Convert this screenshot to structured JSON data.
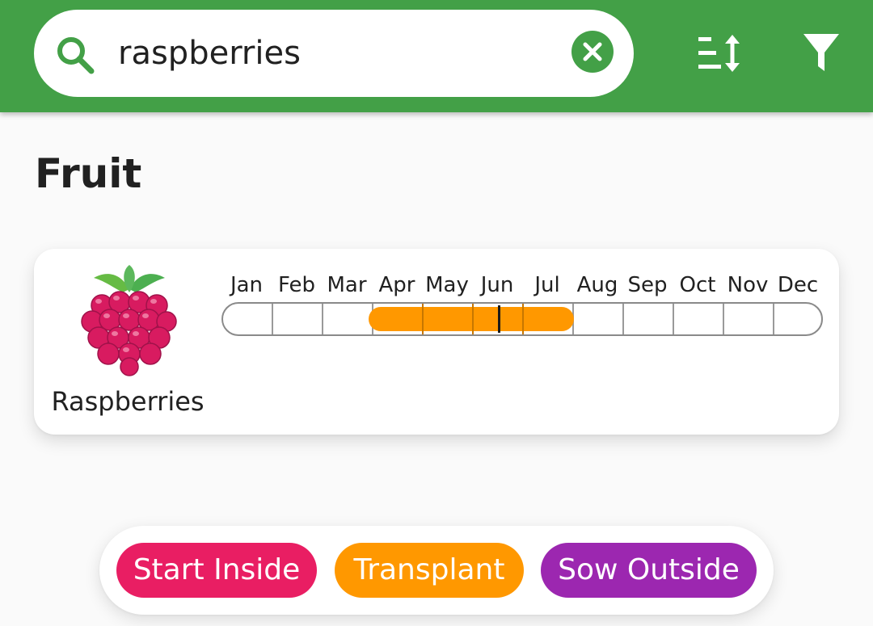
{
  "search": {
    "value": "raspberries",
    "icon": "search-icon",
    "clear_icon": "close-circle-icon"
  },
  "toolbar": {
    "sort_icon": "sort-icon",
    "filter_icon": "filter-icon"
  },
  "colors": {
    "primary": "#43a047",
    "start_inside": "#e91e63",
    "transplant": "#ff9800",
    "sow_outside": "#9c27b0"
  },
  "section": {
    "title": "Fruit"
  },
  "plants": [
    {
      "name": "Raspberries",
      "icon": "raspberry-icon",
      "months": [
        "Jan",
        "Feb",
        "Mar",
        "Apr",
        "May",
        "Jun",
        "Jul",
        "Aug",
        "Sep",
        "Oct",
        "Nov",
        "Dec"
      ],
      "transplant_start_month": 4,
      "transplant_end_month": 7,
      "current_month_fraction": 5.55
    }
  ],
  "legend": {
    "start_inside": "Start Inside",
    "transplant": "Transplant",
    "sow_outside": "Sow Outside"
  }
}
